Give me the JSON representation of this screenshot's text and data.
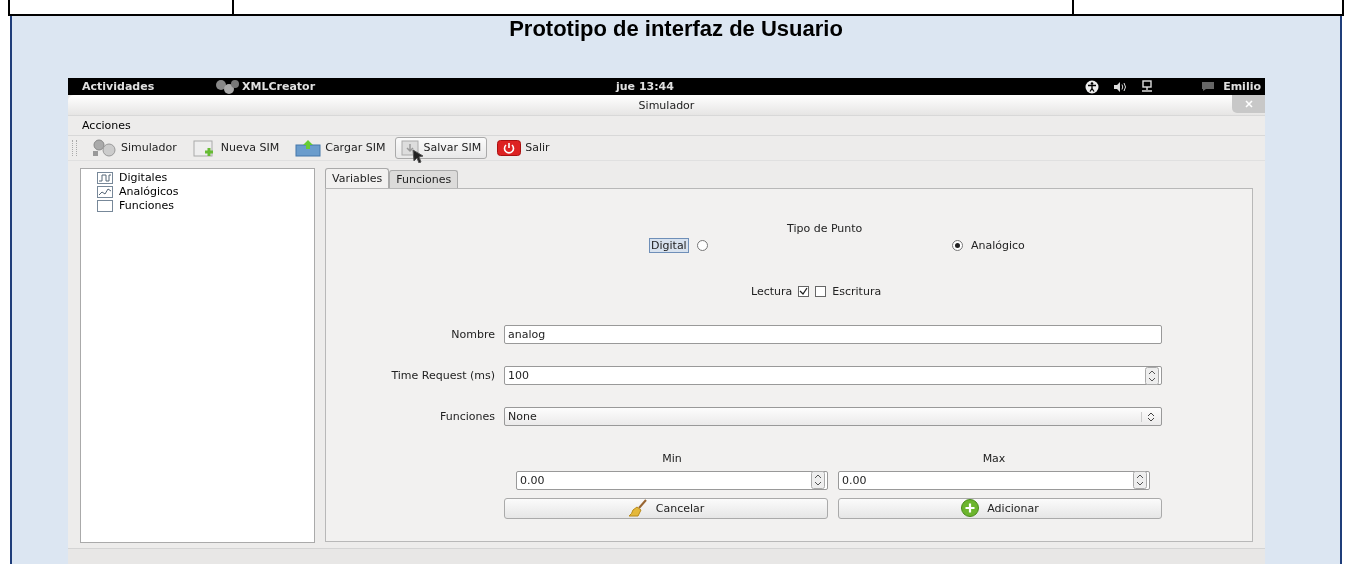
{
  "document": {
    "title": "Prototipo de interfaz de Usuario"
  },
  "top_bar": {
    "activities": "Actividades",
    "app": "XMLCreator",
    "clock": "jue 13:44",
    "user": "Emilio"
  },
  "window": {
    "title": "Simulador"
  },
  "menu": [
    {
      "label": "Acciones"
    }
  ],
  "toolbar": [
    {
      "label": "Simulador",
      "hovered": false
    },
    {
      "label": "Nueva SIM",
      "hovered": false
    },
    {
      "label": "Cargar SIM",
      "hovered": false
    },
    {
      "label": "Salvar SIM",
      "hovered": true
    },
    {
      "label": "Salir",
      "hovered": false
    }
  ],
  "tree": [
    {
      "label": "Digitales"
    },
    {
      "label": "Analógicos"
    },
    {
      "label": "Funciones"
    }
  ],
  "tabs": [
    {
      "label": "Variables",
      "selected": true
    },
    {
      "label": "Funciones",
      "selected": false
    }
  ],
  "form": {
    "point_type_label": "Tipo de Punto",
    "point_types": [
      {
        "label": "Digital",
        "selected": false,
        "focused": true
      },
      {
        "label": "Analógico",
        "selected": true,
        "focused": false
      }
    ],
    "access": [
      {
        "label": "Lectura",
        "checked": true
      },
      {
        "label": "Escritura",
        "checked": false
      }
    ],
    "fields": [
      {
        "label": "Nombre",
        "value": "analog",
        "kind": "text"
      },
      {
        "label": "Time Request (ms)",
        "value": "100",
        "kind": "spin"
      },
      {
        "label": "Funciones",
        "value": "None",
        "kind": "combo"
      }
    ],
    "range": [
      {
        "label": "Min",
        "value": "0.00"
      },
      {
        "label": "Max",
        "value": "0.00"
      }
    ],
    "buttons": [
      {
        "label": "Cancelar"
      },
      {
        "label": "Adicionar"
      }
    ]
  }
}
